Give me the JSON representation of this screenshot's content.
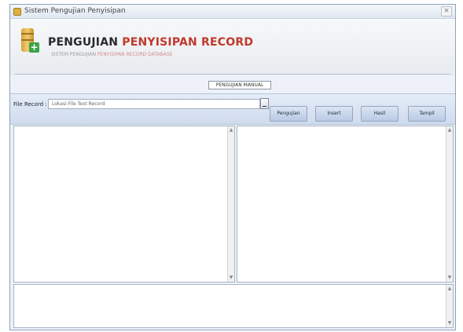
{
  "window": {
    "title": "Sistem Pengujian Penyisipan",
    "close_glyph": "×"
  },
  "header": {
    "title_part1": "PENGUJIAN",
    "title_part2": "PENYISIPAN RECORD",
    "subtitle_part1": "SISTEM PENGUJIAN",
    "subtitle_part2": "PENYISIPAN RECORD DATABASE"
  },
  "mode_label": "PENGUJIAN MANUAL",
  "toolbar": {
    "file_label": "File Record :",
    "file_placeholder": "Lokasi File Text Record",
    "buttons": [
      "Pengujian",
      "Insert",
      "Hasil",
      "Tampil"
    ]
  },
  "icons": {
    "app": "database-app-icon",
    "logo": "database-add-icon",
    "browse": "browse-icon"
  }
}
